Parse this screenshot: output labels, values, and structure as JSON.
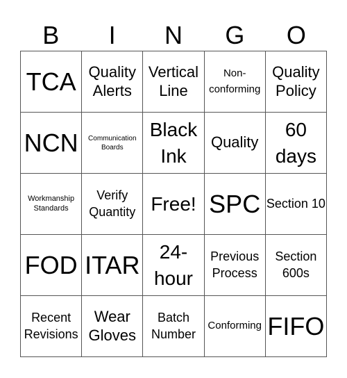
{
  "header": {
    "letters": [
      "B",
      "I",
      "N",
      "G",
      "O"
    ]
  },
  "cells": [
    {
      "text": "TCA",
      "size": "s-xl"
    },
    {
      "text": "Quality Alerts",
      "size": "s-md"
    },
    {
      "text": "Vertical Line",
      "size": "s-md"
    },
    {
      "text": "Non-conforming",
      "size": "s-xs"
    },
    {
      "text": "Quality Policy",
      "size": "s-md"
    },
    {
      "text": "NCN",
      "size": "s-xl"
    },
    {
      "text": "Communication Boards",
      "size": "s-tiny"
    },
    {
      "text": "Black Ink",
      "size": "s-lg"
    },
    {
      "text": "Quality",
      "size": "s-md"
    },
    {
      "text": "60 days",
      "size": "s-lg"
    },
    {
      "text": "Workmanship Standards",
      "size": "s-xxs"
    },
    {
      "text": "Verify Quantity",
      "size": "s-sm"
    },
    {
      "text": "Free!",
      "size": "s-lg"
    },
    {
      "text": "SPC",
      "size": "s-xl"
    },
    {
      "text": "Section 10",
      "size": "s-sm"
    },
    {
      "text": "FOD",
      "size": "s-xl"
    },
    {
      "text": "ITAR",
      "size": "s-xl"
    },
    {
      "text": "24-hour",
      "size": "s-lg"
    },
    {
      "text": "Previous Process",
      "size": "s-sm"
    },
    {
      "text": "Section 600s",
      "size": "s-sm"
    },
    {
      "text": "Recent Revisions",
      "size": "s-sm"
    },
    {
      "text": "Wear Gloves",
      "size": "s-md"
    },
    {
      "text": "Batch Number",
      "size": "s-sm"
    },
    {
      "text": "Conforming",
      "size": "s-xs"
    },
    {
      "text": "FIFO",
      "size": "s-xl"
    }
  ]
}
